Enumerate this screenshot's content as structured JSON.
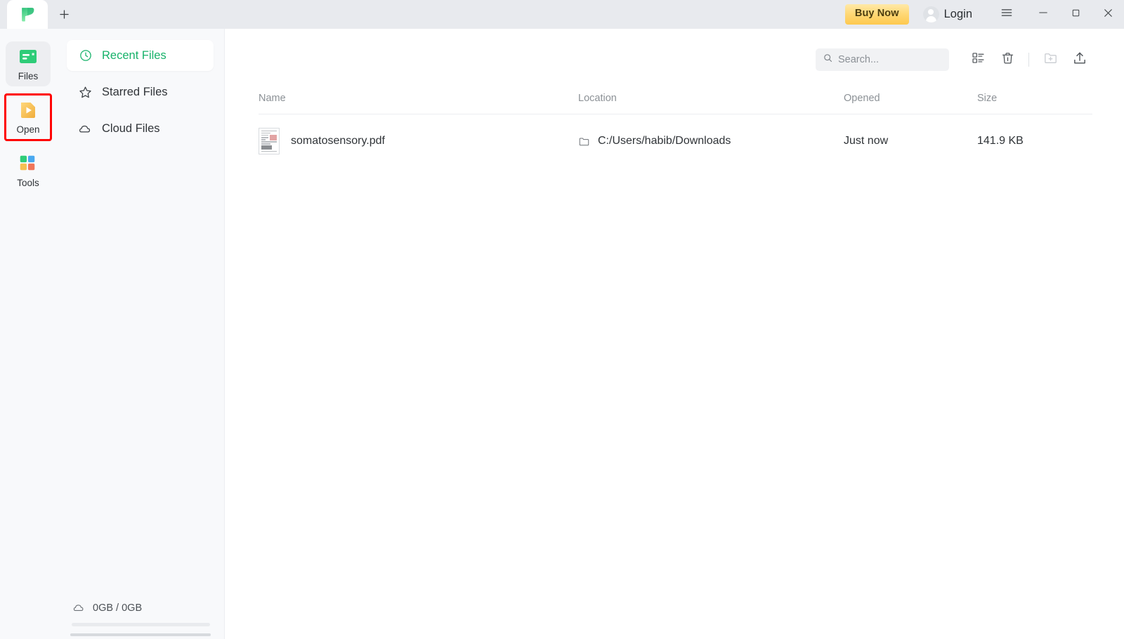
{
  "titlebar": {
    "logo_icon": "pdf-app-leaf-logo",
    "new_tab_icon": "plus-icon",
    "buy_now_label": "Buy Now",
    "login_label": "Login",
    "avatar_icon": "user-avatar-icon",
    "menu_icon": "hamburger-menu-icon",
    "minimize_icon": "minimize-icon",
    "maximize_icon": "maximize-icon",
    "close_icon": "close-icon"
  },
  "rail": {
    "items": [
      {
        "label": "Files",
        "icon": "files-document-icon",
        "active": true,
        "highlighted": false
      },
      {
        "label": "Open",
        "icon": "open-folder-play-icon",
        "active": false,
        "highlighted": true
      },
      {
        "label": "Tools",
        "icon": "tools-grid-icon",
        "active": false,
        "highlighted": false
      }
    ]
  },
  "sidebar": {
    "items": [
      {
        "label": "Recent Files",
        "icon": "clock-icon",
        "active": true
      },
      {
        "label": "Starred Files",
        "icon": "star-icon",
        "active": false
      },
      {
        "label": "Cloud Files",
        "icon": "cloud-icon",
        "active": false
      }
    ],
    "storage": {
      "icon": "cloud-icon",
      "label": "0GB / 0GB",
      "used_percent": 0
    }
  },
  "toolbar": {
    "search": {
      "placeholder": "Search...",
      "value": "",
      "icon": "search-icon"
    },
    "buttons": [
      {
        "name": "list-view-icon",
        "label": "List view",
        "disabled": false
      },
      {
        "name": "trash-icon",
        "label": "Delete",
        "disabled": false
      },
      {
        "name": "new-folder-icon",
        "label": "New folder",
        "disabled": true
      },
      {
        "name": "upload-icon",
        "label": "Upload",
        "disabled": false
      }
    ]
  },
  "file_table": {
    "columns": [
      "Name",
      "Location",
      "Opened",
      "Size"
    ],
    "rows": [
      {
        "name": "somatosensory.pdf",
        "location": "C:/Users/habib/Downloads",
        "opened": "Just now",
        "size": "141.9 KB",
        "thumbnail_icon": "pdf-page-thumbnail",
        "location_icon": "folder-icon"
      }
    ]
  },
  "colors": {
    "accent_green": "#17b26a",
    "buy_now_gold": "#fdc94f",
    "titlebar_bg": "#e8eaee",
    "sidebar_bg": "#f8f9fb",
    "highlight_box": "#ff0000"
  }
}
